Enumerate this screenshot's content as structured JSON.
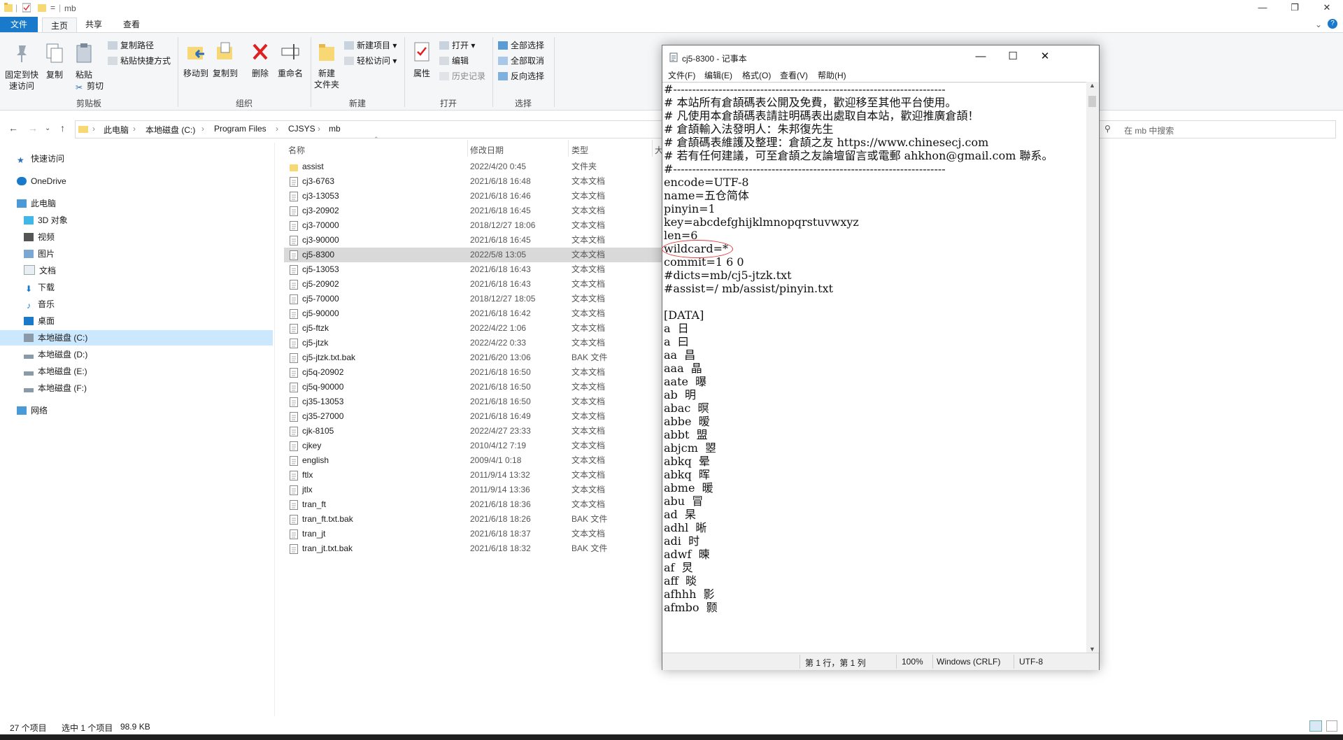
{
  "explorer": {
    "title": "mb",
    "tabs": {
      "file": "文件",
      "home": "主页",
      "share": "共享",
      "view": "查看"
    },
    "ribbon": {
      "pin_label_1": "固定到快",
      "pin_label_2": "速访问",
      "copy": "复制",
      "paste": "粘贴",
      "copy_path": "复制路径",
      "paste_shortcut": "粘贴快捷方式",
      "cut": "剪切",
      "clipboard_group": "剪贴板",
      "move_to": "移动到",
      "copy_to": "复制到",
      "delete": "删除",
      "rename": "重命名",
      "organize_group": "组织",
      "new_folder_1": "新建",
      "new_folder_2": "文件夹",
      "new_item": "新建项目",
      "easy_access": "轻松访问",
      "new_group": "新建",
      "properties": "属性",
      "open": "打开",
      "edit": "编辑",
      "history": "历史记录",
      "open_group": "打开",
      "select_all": "全部选择",
      "select_none": "全部取消",
      "invert_selection": "反向选择",
      "select_group": "选择"
    },
    "breadcrumb": [
      "此电脑",
      "本地磁盘 (C:)",
      "Program Files",
      "CJSYS",
      "mb"
    ],
    "search_placeholder": "在 mb 中搜索",
    "nav": {
      "quick_access": "快速访问",
      "onedrive": "OneDrive",
      "this_pc": "此电脑",
      "objects3d": "3D 对象",
      "videos": "视频",
      "pictures": "图片",
      "documents": "文档",
      "downloads": "下载",
      "music": "音乐",
      "desktop": "桌面",
      "drive_c": "本地磁盘 (C:)",
      "drive_d": "本地磁盘 (D:)",
      "drive_e": "本地磁盘 (E:)",
      "drive_f": "本地磁盘 (F:)",
      "network": "网络"
    },
    "columns": {
      "name": "名称",
      "date": "修改日期",
      "type": "类型",
      "size": "大"
    },
    "files": [
      {
        "name": "assist",
        "date": "2022/4/20 0:45",
        "type": "文件夹"
      },
      {
        "name": "cj3-6763",
        "date": "2021/6/18 16:48",
        "type": "文本文档"
      },
      {
        "name": "cj3-13053",
        "date": "2021/6/18 16:46",
        "type": "文本文档"
      },
      {
        "name": "cj3-20902",
        "date": "2021/6/18 16:45",
        "type": "文本文档"
      },
      {
        "name": "cj3-70000",
        "date": "2018/12/27 18:06",
        "type": "文本文档"
      },
      {
        "name": "cj3-90000",
        "date": "2021/6/18 16:45",
        "type": "文本文档"
      },
      {
        "name": "cj5-8300",
        "date": "2022/5/8 13:05",
        "type": "文本文档"
      },
      {
        "name": "cj5-13053",
        "date": "2021/6/18 16:43",
        "type": "文本文档"
      },
      {
        "name": "cj5-20902",
        "date": "2021/6/18 16:43",
        "type": "文本文档"
      },
      {
        "name": "cj5-70000",
        "date": "2018/12/27 18:05",
        "type": "文本文档"
      },
      {
        "name": "cj5-90000",
        "date": "2021/6/18 16:42",
        "type": "文本文档"
      },
      {
        "name": "cj5-ftzk",
        "date": "2022/4/22 1:06",
        "type": "文本文档"
      },
      {
        "name": "cj5-jtzk",
        "date": "2022/4/22 0:33",
        "type": "文本文档"
      },
      {
        "name": "cj5-jtzk.txt.bak",
        "date": "2021/6/20 13:06",
        "type": "BAK 文件"
      },
      {
        "name": "cj5q-20902",
        "date": "2021/6/18 16:50",
        "type": "文本文档"
      },
      {
        "name": "cj5q-90000",
        "date": "2021/6/18 16:50",
        "type": "文本文档"
      },
      {
        "name": "cj35-13053",
        "date": "2021/6/18 16:50",
        "type": "文本文档"
      },
      {
        "name": "cj35-27000",
        "date": "2021/6/18 16:49",
        "type": "文本文档"
      },
      {
        "name": "cjk-8105",
        "date": "2022/4/27 23:33",
        "type": "文本文档"
      },
      {
        "name": "cjkey",
        "date": "2010/4/12 7:19",
        "type": "文本文档"
      },
      {
        "name": "english",
        "date": "2009/4/1 0:18",
        "type": "文本文档"
      },
      {
        "name": "ftlx",
        "date": "2011/9/14 13:32",
        "type": "文本文档"
      },
      {
        "name": "jtlx",
        "date": "2011/9/14 13:36",
        "type": "文本文档"
      },
      {
        "name": "tran_ft",
        "date": "2021/6/18 18:36",
        "type": "文本文档"
      },
      {
        "name": "tran_ft.txt.bak",
        "date": "2021/6/18 18:26",
        "type": "BAK 文件"
      },
      {
        "name": "tran_jt",
        "date": "2021/6/18 18:37",
        "type": "文本文档"
      },
      {
        "name": "tran_jt.txt.bak",
        "date": "2021/6/18 18:32",
        "type": "BAK 文件"
      }
    ],
    "status": {
      "count": "27 个项目",
      "selected": "选中 1 个项目",
      "size": "98.9 KB"
    }
  },
  "notepad": {
    "title": "cj5-8300 - 记事本",
    "menu": [
      "文件(F)",
      "编辑(E)",
      "格式(O)",
      "查看(V)",
      "帮助(H)"
    ],
    "content": "#------------------------------------------------------------------------\n# 本站所有倉頡碼表公開及免費，歡迎移至其他平台使用。\n# 凡使用本倉頡碼表請註明碼表出處取自本站，歡迎推廣倉頡！\n# 倉頡輸入法發明人：朱邦復先生\n# 倉頡碼表維護及整理：倉頡之友 https://www.chinesecj.com\n# 若有任何建議，可至倉頡之友論壇留言或電郵 ahkhon@gmail.com 聯系。\n#------------------------------------------------------------------------\nencode=UTF-8\nname=五仓简体\npinyin=1\nkey=abcdefghijklmnopqrstuvwxyz\nlen=6\nwildcard=*\ncommit=1 6 0\n#dicts=mb/cj5-jtzk.txt\n#assist=/ mb/assist/pinyin.txt\n\n[DATA]\na  日\na  曰\naa  昌\naaa  晶\naate  曝\nab  明\nabac  暝\nabbe  暧\nabbt  盟\nabjcm  曌\nabkq  晕\nabkq  晖\nabme  暖\nabu  冒\nad  杲\nadhl  晰\nadi  时\nadwf  暕\naf  炅\naff  晱\nafhhh  影\nafmbo  颢",
    "status": {
      "position": "第 1 行，第 1 列",
      "zoom": "100%",
      "eol": "Windows (CRLF)",
      "encoding": "UTF-8"
    }
  }
}
